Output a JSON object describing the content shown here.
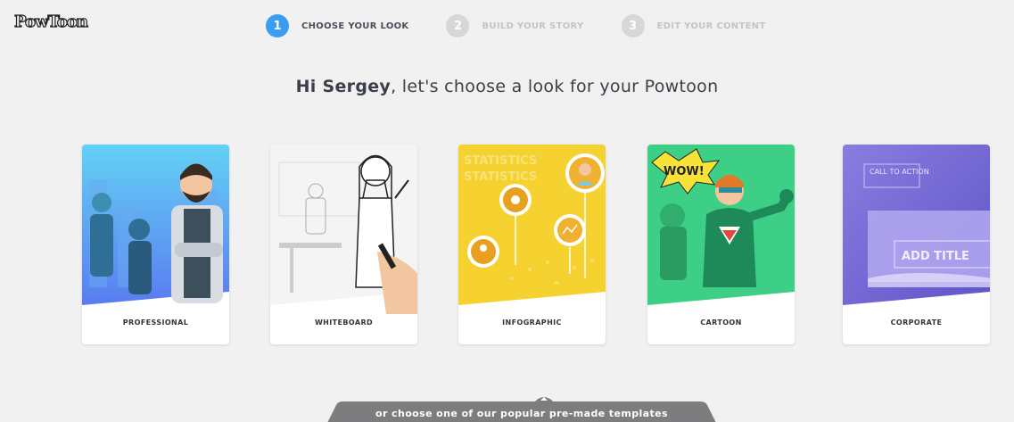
{
  "header": {
    "logo_text": "PowToon",
    "steps": [
      {
        "number": "1",
        "label": "CHOOSE YOUR LOOK"
      },
      {
        "number": "2",
        "label": "BUILD YOUR STORY"
      },
      {
        "number": "3",
        "label": "EDIT YOUR CONTENT"
      }
    ]
  },
  "greeting": {
    "name": "Hi Sergey",
    "rest": ", let's choose a look for your Powtoon"
  },
  "looks": [
    {
      "label": "PROFESSIONAL"
    },
    {
      "label": "WHITEBOARD"
    },
    {
      "label": "INFOGRAPHIC",
      "art_text": "STATISTICS"
    },
    {
      "label": "CARTOON",
      "art_text": "WOW!"
    },
    {
      "label": "CORPORATE",
      "art_text_1": "CALL TO ACTION",
      "art_text_2": "ADD TITLE"
    }
  ],
  "templates_tab": {
    "label": "or choose one of our popular pre-made templates"
  },
  "colors": {
    "accent": "#3b9cf0",
    "professional": "#63b7f2",
    "infographic": "#f5d22f",
    "cartoon": "#3ecf86",
    "corporate": "#7b6fd8",
    "tab": "#7d7d80"
  }
}
